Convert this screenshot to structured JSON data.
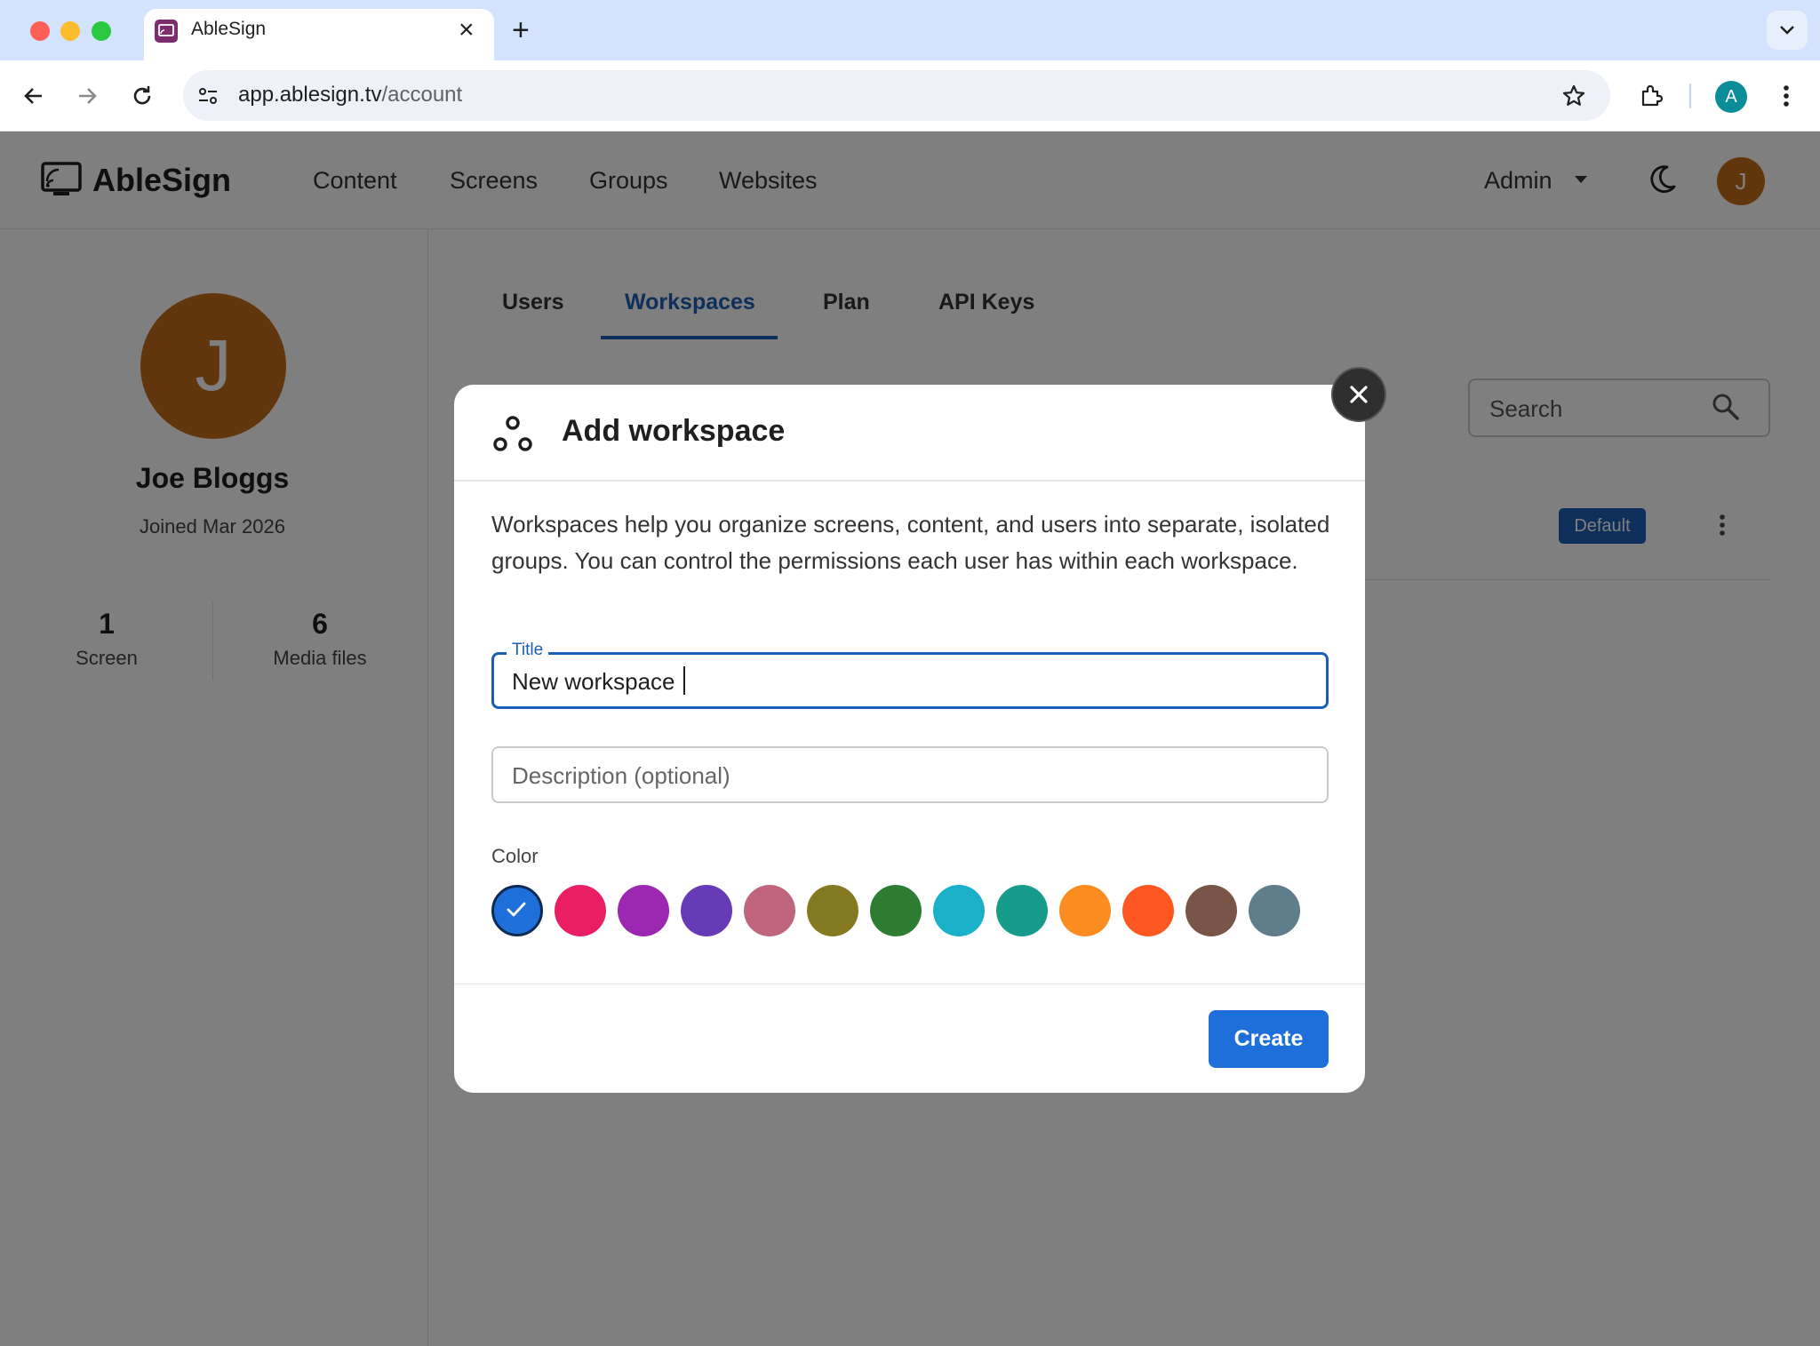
{
  "browser": {
    "tab_title": "AbleSign",
    "url_host": "app.ablesign.tv",
    "url_path": "/account",
    "profile_initial": "A",
    "icons": [
      "back-icon",
      "forward-icon",
      "reload-icon",
      "site-settings-icon",
      "bookmark-star-icon",
      "extensions-icon",
      "more-vert-icon"
    ]
  },
  "header": {
    "logo_text": "AbleSign",
    "nav": [
      "Content",
      "Screens",
      "Groups",
      "Websites"
    ],
    "admin_label": "Admin",
    "avatar_initial": "J"
  },
  "profile": {
    "avatar_initial": "J",
    "name": "Joe Bloggs",
    "joined": "Joined Mar 2026",
    "stats": [
      {
        "value": "1",
        "label": "Screen"
      },
      {
        "value": "6",
        "label": "Media files"
      }
    ]
  },
  "account_tabs": [
    "Users",
    "Workspaces",
    "Plan",
    "API Keys"
  ],
  "active_tab": "Workspaces",
  "search": {
    "placeholder": "Search"
  },
  "workspace_row": {
    "badge": "Default"
  },
  "modal": {
    "title": "Add workspace",
    "description": "Workspaces help you organize screens, content, and users into separate, isolated groups. You can control the permissions each user has within each workspace.",
    "title_field_label": "Title",
    "title_field_value": "New workspace",
    "description_placeholder": "Description (optional)",
    "color_label": "Color",
    "colors": [
      "#1e6fd9",
      "#e91e63",
      "#9c27b0",
      "#673ab7",
      "#c0657e",
      "#857a22",
      "#2e7d32",
      "#1ab0c8",
      "#179b8a",
      "#fb8c1f",
      "#ff5722",
      "#795548",
      "#607d8b"
    ],
    "selected_color": "#1e6fd9",
    "create_label": "Create"
  }
}
